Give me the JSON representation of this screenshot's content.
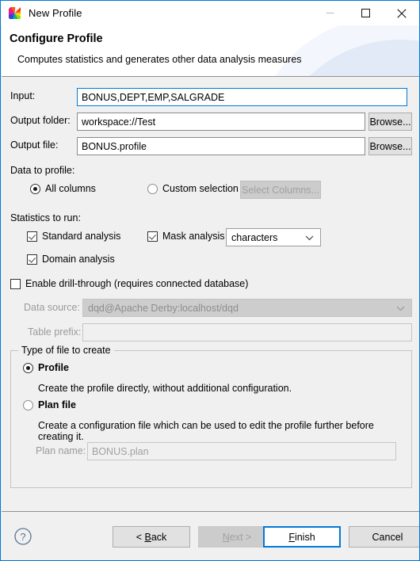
{
  "window": {
    "title": "New Profile",
    "icon": "rainbow-pinwheel-icon",
    "minimize_label": "—",
    "maximize_label": "□",
    "close_label": "✕"
  },
  "header": {
    "title": "Configure Profile",
    "subtitle": "Computes statistics and generates other data analysis measures"
  },
  "fields": {
    "input_label": "Input:",
    "input_value": "BONUS,DEPT,EMP,SALGRADE",
    "output_folder_label": "Output folder:",
    "output_folder_value": "workspace://Test",
    "output_folder_browse": "Browse...",
    "output_file_label": "Output file:",
    "output_file_value": "BONUS.profile",
    "output_file_browse": "Browse..."
  },
  "data_to_profile": {
    "label": "Data to profile:",
    "all_columns": "All columns",
    "custom_selection": "Custom selection",
    "select_columns_button": "Select Columns...",
    "selected": "all_columns"
  },
  "statistics": {
    "label": "Statistics to run:",
    "standard_analysis": "Standard analysis",
    "standard_checked": true,
    "domain_analysis": "Domain analysis",
    "domain_checked": true,
    "mask_analysis": "Mask analysis",
    "mask_checked": true,
    "mask_mode_value": "characters",
    "mask_mode_options": [
      "characters"
    ]
  },
  "drill_through": {
    "enable_label": "Enable drill-through (requires connected database)",
    "enabled": false,
    "data_source_label": "Data source:",
    "data_source_value": "dqd@Apache Derby:localhost/dqd",
    "table_prefix_label": "Table prefix:",
    "table_prefix_value": ""
  },
  "file_type_group": {
    "legend": "Type of file to create",
    "profile_label": "Profile",
    "profile_desc": "Create the profile directly, without additional configuration.",
    "plan_label": "Plan file",
    "plan_desc": "Create a configuration file which can be used to edit the profile further before creating it.",
    "selected": "profile",
    "plan_name_label": "Plan name:",
    "plan_name_value": "BONUS.plan"
  },
  "footer": {
    "help_icon": "help-circle-icon",
    "back": "< Back",
    "back_mnemonic": "B",
    "next": "Next >",
    "next_mnemonic": "N",
    "finish": "Finish",
    "finish_mnemonic": "F",
    "cancel": "Cancel"
  },
  "colors": {
    "accent": "#0078d7",
    "dialog_bg": "#f0f0f0",
    "header_bg": "#ffffff",
    "disabled_text": "#a0a0a0"
  }
}
